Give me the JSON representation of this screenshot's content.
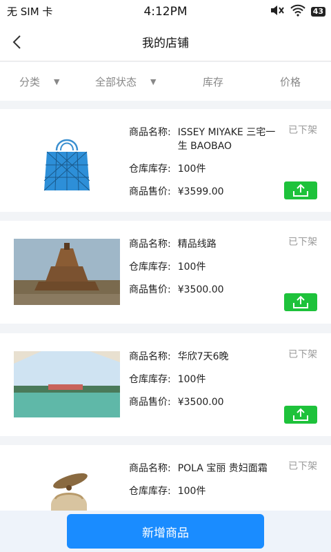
{
  "statusbar": {
    "carrier": "无 SIM 卡",
    "time": "4:12PM",
    "battery": "43"
  },
  "navbar": {
    "title": "我的店铺"
  },
  "filters": {
    "category": "分类",
    "all_status": "全部状态",
    "stock": "库存",
    "price": "价格"
  },
  "labels": {
    "name": "商品名称:",
    "stock": "仓库库存:",
    "price": "商品售价:"
  },
  "products": [
    {
      "name": "ISSEY MIYAKE 三宅一生 BAOBAO",
      "stock": "100件",
      "price": "¥3599.00",
      "status": "已下架",
      "image": "blue-geometric-tote-bag"
    },
    {
      "name": "精品线路",
      "stock": "100件",
      "price": "¥3500.00",
      "status": "已下架",
      "image": "ancient-temple-ruins"
    },
    {
      "name": "华欣7天6晚",
      "stock": "100件",
      "price": "¥3500.00",
      "status": "已下架",
      "image": "resort-lagoon"
    },
    {
      "name": "POLA 宝丽 贵妇面霜",
      "stock": "100件",
      "price": "",
      "status": "已下架",
      "image": "gold-cream-jar"
    }
  ],
  "footer": {
    "add_label": "新增商品"
  },
  "colors": {
    "accent": "#1a8cff",
    "green": "#1ec23b"
  }
}
